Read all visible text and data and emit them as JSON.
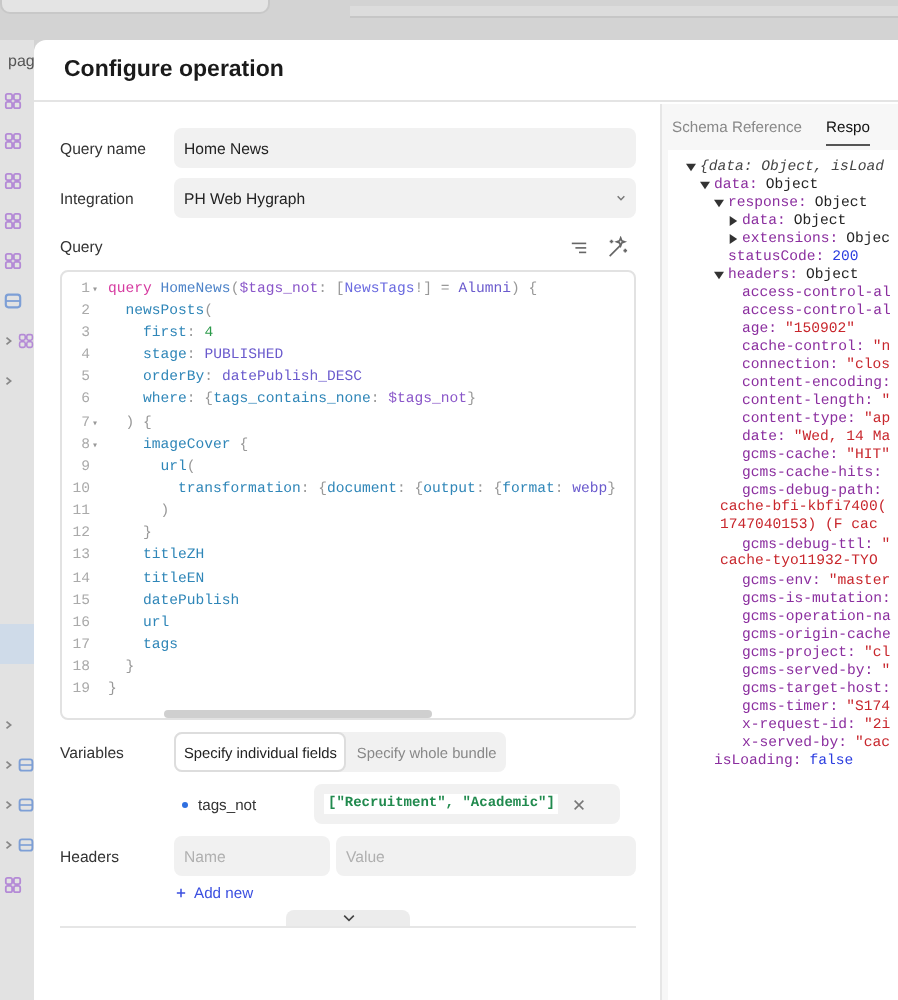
{
  "sidebar": {
    "top_items": [
      {
        "kind": "page",
        "label": "pag",
        "selected": false
      },
      {
        "kind": "component",
        "selected": false
      },
      {
        "kind": "component",
        "selected": false
      },
      {
        "kind": "component",
        "selected": false
      },
      {
        "kind": "component",
        "selected": false
      },
      {
        "kind": "component",
        "selected": false
      },
      {
        "kind": "page",
        "selected": false
      },
      {
        "kind": "chevron-component",
        "selected": false
      },
      {
        "kind": "chevron",
        "selected": false
      }
    ],
    "bottom_items": [
      {
        "kind": "blank",
        "selected": true
      },
      {
        "kind": "chevron",
        "selected": false
      },
      {
        "kind": "chevron-page",
        "selected": false
      },
      {
        "kind": "chevron-page",
        "selected": false
      },
      {
        "kind": "chevron-page",
        "selected": false
      },
      {
        "kind": "component",
        "selected": false
      }
    ]
  },
  "dialog": {
    "title": "Configure operation",
    "query_name": {
      "label": "Query name",
      "value": "Home News"
    },
    "integration": {
      "label": "Integration",
      "value": "PH Web Hygraph"
    },
    "query": {
      "label": "Query",
      "lines": [
        {
          "number": "1",
          "fold": "▾",
          "tokens": [
            {
              "kind": "keyword",
              "text": "query "
            },
            {
              "kind": "def",
              "text": "HomeNews"
            },
            {
              "kind": "punct",
              "text": "("
            },
            {
              "kind": "variable",
              "text": "$tags_not"
            },
            {
              "kind": "punct",
              "text": ": ["
            },
            {
              "kind": "type",
              "text": "NewsTags"
            },
            {
              "kind": "punct",
              "text": "!] = "
            },
            {
              "kind": "atom",
              "text": "Alumni"
            },
            {
              "kind": "punct",
              "text": ") {"
            }
          ]
        },
        {
          "number": "2",
          "tokens": [
            {
              "kind": "property",
              "text": "  newsPosts"
            },
            {
              "kind": "punct",
              "text": "("
            }
          ]
        },
        {
          "number": "3",
          "tokens": [
            {
              "kind": "property",
              "text": "    first"
            },
            {
              "kind": "punct",
              "text": ": "
            },
            {
              "kind": "number",
              "text": "4"
            }
          ]
        },
        {
          "number": "4",
          "tokens": [
            {
              "kind": "property",
              "text": "    stage"
            },
            {
              "kind": "punct",
              "text": ": "
            },
            {
              "kind": "atom",
              "text": "PUBLISHED"
            }
          ]
        },
        {
          "number": "5",
          "tokens": [
            {
              "kind": "property",
              "text": "    orderBy"
            },
            {
              "kind": "punct",
              "text": ": "
            },
            {
              "kind": "atom",
              "text": "datePublish_DESC"
            }
          ]
        },
        {
          "number": "6",
          "tokens": [
            {
              "kind": "property",
              "text": "    where"
            },
            {
              "kind": "punct",
              "text": ": {"
            },
            {
              "kind": "property",
              "text": "tags_contains_none"
            },
            {
              "kind": "punct",
              "text": ": "
            },
            {
              "kind": "variable",
              "text": "$tags_not"
            },
            {
              "kind": "punct",
              "text": "}"
            }
          ]
        },
        {
          "number": "7",
          "fold": "▾",
          "tokens": [
            {
              "kind": "punct",
              "text": "  ) {"
            }
          ]
        },
        {
          "number": "8",
          "fold": "▾",
          "tokens": [
            {
              "kind": "property",
              "text": "    imageCover"
            },
            {
              "kind": "punct",
              "text": " {"
            }
          ]
        },
        {
          "number": "9",
          "tokens": [
            {
              "kind": "property",
              "text": "      url"
            },
            {
              "kind": "punct",
              "text": "("
            }
          ]
        },
        {
          "number": "10",
          "tokens": [
            {
              "kind": "property",
              "text": "        transformation"
            },
            {
              "kind": "punct",
              "text": ": {"
            },
            {
              "kind": "property",
              "text": "document"
            },
            {
              "kind": "punct",
              "text": ": {"
            },
            {
              "kind": "property",
              "text": "output"
            },
            {
              "kind": "punct",
              "text": ": {"
            },
            {
              "kind": "property",
              "text": "format"
            },
            {
              "kind": "punct",
              "text": ": "
            },
            {
              "kind": "atom",
              "text": "webp"
            },
            {
              "kind": "punct",
              "text": "}"
            }
          ]
        },
        {
          "number": "11",
          "tokens": [
            {
              "kind": "punct",
              "text": "      )"
            }
          ]
        },
        {
          "number": "12",
          "tokens": [
            {
              "kind": "punct",
              "text": "    }"
            }
          ]
        },
        {
          "number": "13",
          "tokens": [
            {
              "kind": "property",
              "text": "    titleZH"
            }
          ]
        },
        {
          "number": "14",
          "tokens": [
            {
              "kind": "property",
              "text": "    titleEN"
            }
          ]
        },
        {
          "number": "15",
          "tokens": [
            {
              "kind": "property",
              "text": "    datePublish"
            }
          ]
        },
        {
          "number": "16",
          "tokens": [
            {
              "kind": "property",
              "text": "    url"
            }
          ]
        },
        {
          "number": "17",
          "tokens": [
            {
              "kind": "property",
              "text": "    tags"
            }
          ]
        },
        {
          "number": "18",
          "tokens": [
            {
              "kind": "punct",
              "text": "  }"
            }
          ]
        },
        {
          "number": "19",
          "tokens": [
            {
              "kind": "punct",
              "text": "}"
            }
          ]
        }
      ]
    },
    "variables": {
      "label": "Variables",
      "modes": [
        {
          "label": "Specify individual fields",
          "selected": true
        },
        {
          "label": "Specify whole bundle",
          "selected": false
        }
      ],
      "items": [
        {
          "name": "tags_not",
          "value": "[\"Recruitment\", \"Academic\"]"
        }
      ]
    },
    "headers": {
      "label": "Headers",
      "name_placeholder": "Name",
      "value_placeholder": "Value",
      "add_label": "Add new"
    }
  },
  "response_panel": {
    "tabs": [
      {
        "label": "Schema Reference",
        "selected": false
      },
      {
        "label": "Respo",
        "selected": true
      }
    ],
    "tree": {
      "summary": "{data: Object, isLoad",
      "expanded": true,
      "children": [
        {
          "key": "data:",
          "value": "Object",
          "kind": "object",
          "expanded": true,
          "children": [
            {
              "key": "response:",
              "value": "Object",
              "kind": "object",
              "expanded": true,
              "children": [
                {
                  "key": "data:",
                  "value": "Object",
                  "kind": "object",
                  "expanded": false
                },
                {
                  "key": "extensions:",
                  "value": "Objec",
                  "kind": "object",
                  "expanded": false
                }
              ]
            },
            {
              "key": "statusCode:",
              "value": "200",
              "kind": "number"
            },
            {
              "key": "headers:",
              "value": "Object",
              "kind": "object",
              "expanded": true,
              "children": [
                {
                  "key": "access-control-al"
                },
                {
                  "key": "access-control-al"
                },
                {
                  "key": "age:",
                  "value": "\"150902\"",
                  "kind": "string"
                },
                {
                  "key": "cache-control:",
                  "value": "\"n",
                  "kind": "string"
                },
                {
                  "key": "connection:",
                  "value": "\"clos",
                  "kind": "string"
                },
                {
                  "key": "content-encoding:"
                },
                {
                  "key": "content-length:",
                  "value": "\"",
                  "kind": "string"
                },
                {
                  "key": "content-type:",
                  "value": "\"ap",
                  "kind": "string"
                },
                {
                  "key": "date:",
                  "value": "\"Wed, 14 Ma",
                  "kind": "string"
                },
                {
                  "key": "gcms-cache:",
                  "value": "\"HIT\"",
                  "kind": "string"
                },
                {
                  "key": "gcms-cache-hits:"
                },
                {
                  "key": "gcms-debug-path:",
                  "wrap": [
                    "cache-bfi-kbfi7400(",
                    "1747040153) (F cac"
                  ]
                },
                {
                  "key": "gcms-debug-ttl:",
                  "value": "\"",
                  "kind": "string",
                  "wrap": [
                    "cache-tyo11932-TYO"
                  ]
                },
                {
                  "key": "gcms-env:",
                  "value": "\"master",
                  "kind": "string"
                },
                {
                  "key": "gcms-is-mutation:"
                },
                {
                  "key": "gcms-operation-na"
                },
                {
                  "key": "gcms-origin-cache"
                },
                {
                  "key": "gcms-project:",
                  "value": "\"cl",
                  "kind": "string"
                },
                {
                  "key": "gcms-served-by:",
                  "value": "\"",
                  "kind": "string"
                },
                {
                  "key": "gcms-target-host:"
                },
                {
                  "key": "gcms-timer:",
                  "value": "\"S174",
                  "kind": "string"
                },
                {
                  "key": "x-request-id:",
                  "value": "\"2i",
                  "kind": "string"
                },
                {
                  "key": "x-served-by:",
                  "value": "\"cac",
                  "kind": "string"
                }
              ]
            }
          ]
        },
        {
          "key": "isLoading:",
          "value": "false",
          "kind": "boolean"
        }
      ]
    }
  }
}
